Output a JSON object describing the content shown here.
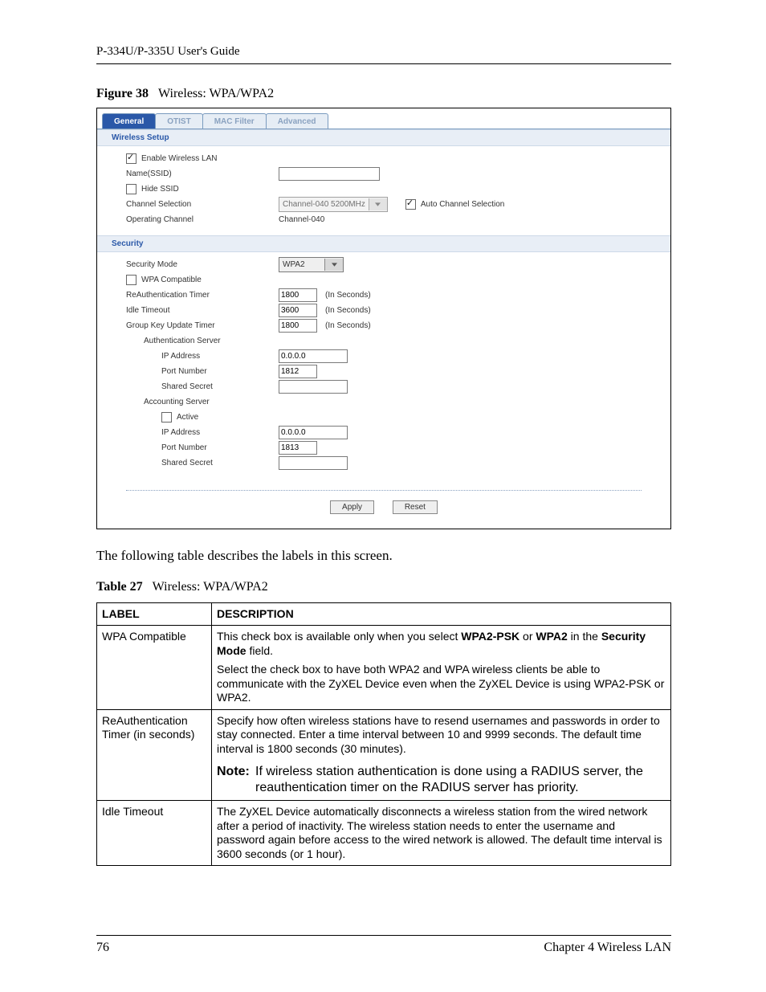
{
  "header": {
    "guide": "P-334U/P-335U User's Guide"
  },
  "figure": {
    "label": "Figure 38",
    "title": "Wireless: WPA/WPA2"
  },
  "shot": {
    "tabs": {
      "general": "General",
      "otist": "OTIST",
      "mac": "MAC Filter",
      "advanced": "Advanced"
    },
    "wireless_setup": {
      "heading": "Wireless Setup",
      "enable_label": "Enable Wireless LAN",
      "name_label": "Name(SSID)",
      "hide_label": "Hide SSID",
      "channel_sel_label": "Channel Selection",
      "channel_value": "Channel-040 5200MHz",
      "auto_label": "Auto Channel Selection",
      "operating_label": "Operating Channel",
      "operating_value": "Channel-040"
    },
    "security": {
      "heading": "Security",
      "mode_label": "Security Mode",
      "mode_value": "WPA2",
      "wpa_compat_label": "WPA Compatible",
      "reauth_label": "ReAuthentication Timer",
      "reauth_value": "1800",
      "idle_label": "Idle Timeout",
      "idle_value": "3600",
      "group_label": "Group Key Update Timer",
      "group_value": "1800",
      "seconds": "(In Seconds)",
      "auth_server": "Authentication Server",
      "ip_label": "IP Address",
      "auth_ip": "0.0.0.0",
      "port_label": "Port Number",
      "auth_port": "1812",
      "secret_label": "Shared Secret",
      "acct_server": "Accounting Server",
      "active_label": "Active",
      "acct_ip": "0.0.0.0",
      "acct_port": "1813"
    },
    "buttons": {
      "apply": "Apply",
      "reset": "Reset"
    }
  },
  "para": "The following table describes the labels in this screen.",
  "table_caption": {
    "label": "Table 27",
    "title": "Wireless: WPA/WPA2"
  },
  "table": {
    "h_label": "LABEL",
    "h_desc": "DESCRIPTION",
    "r1_label": "WPA Compatible",
    "r1_p1a": "This check box is available only when you select ",
    "r1_p1b": "WPA2-PSK",
    "r1_p1c": " or ",
    "r1_p1d": "WPA2",
    "r1_p1e": " in the ",
    "r1_p1f": "Security Mode",
    "r1_p1g": " field.",
    "r1_p2": "Select the check box to have both WPA2 and WPA wireless clients be able to communicate with the ZyXEL Device even when the ZyXEL Device is using WPA2-PSK or WPA2.",
    "r2_label": "ReAuthentication Timer (in seconds)",
    "r2_p1": "Specify how often wireless stations have to resend usernames and passwords in order to stay connected. Enter a time interval between 10 and 9999 seconds. The default time interval is 1800 seconds (30 minutes).",
    "r2_note_label": "Note:",
    "r2_note": "If wireless station authentication is done using a RADIUS server, the reauthentication timer on the RADIUS server has priority.",
    "r3_label": "Idle Timeout",
    "r3_p1": "The ZyXEL Device automatically disconnects a wireless station from the wired network after a period of inactivity. The wireless station needs to enter the username and password again before access to the wired network is allowed. The default time interval is 3600 seconds (or 1 hour)."
  },
  "footer": {
    "page": "76",
    "chapter": "Chapter 4 Wireless LAN"
  }
}
